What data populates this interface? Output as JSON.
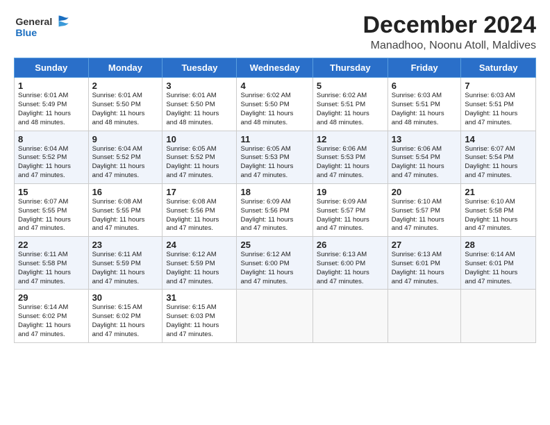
{
  "header": {
    "logo_general": "General",
    "logo_blue": "Blue",
    "title": "December 2024",
    "subtitle": "Manadhoo, Noonu Atoll, Maldives"
  },
  "days_of_week": [
    "Sunday",
    "Monday",
    "Tuesday",
    "Wednesday",
    "Thursday",
    "Friday",
    "Saturday"
  ],
  "weeks": [
    [
      {
        "day": "1",
        "info": "Sunrise: 6:01 AM\nSunset: 5:49 PM\nDaylight: 11 hours\nand 48 minutes."
      },
      {
        "day": "2",
        "info": "Sunrise: 6:01 AM\nSunset: 5:50 PM\nDaylight: 11 hours\nand 48 minutes."
      },
      {
        "day": "3",
        "info": "Sunrise: 6:01 AM\nSunset: 5:50 PM\nDaylight: 11 hours\nand 48 minutes."
      },
      {
        "day": "4",
        "info": "Sunrise: 6:02 AM\nSunset: 5:50 PM\nDaylight: 11 hours\nand 48 minutes."
      },
      {
        "day": "5",
        "info": "Sunrise: 6:02 AM\nSunset: 5:51 PM\nDaylight: 11 hours\nand 48 minutes."
      },
      {
        "day": "6",
        "info": "Sunrise: 6:03 AM\nSunset: 5:51 PM\nDaylight: 11 hours\nand 48 minutes."
      },
      {
        "day": "7",
        "info": "Sunrise: 6:03 AM\nSunset: 5:51 PM\nDaylight: 11 hours\nand 47 minutes."
      }
    ],
    [
      {
        "day": "8",
        "info": "Sunrise: 6:04 AM\nSunset: 5:52 PM\nDaylight: 11 hours\nand 47 minutes."
      },
      {
        "day": "9",
        "info": "Sunrise: 6:04 AM\nSunset: 5:52 PM\nDaylight: 11 hours\nand 47 minutes."
      },
      {
        "day": "10",
        "info": "Sunrise: 6:05 AM\nSunset: 5:52 PM\nDaylight: 11 hours\nand 47 minutes."
      },
      {
        "day": "11",
        "info": "Sunrise: 6:05 AM\nSunset: 5:53 PM\nDaylight: 11 hours\nand 47 minutes."
      },
      {
        "day": "12",
        "info": "Sunrise: 6:06 AM\nSunset: 5:53 PM\nDaylight: 11 hours\nand 47 minutes."
      },
      {
        "day": "13",
        "info": "Sunrise: 6:06 AM\nSunset: 5:54 PM\nDaylight: 11 hours\nand 47 minutes."
      },
      {
        "day": "14",
        "info": "Sunrise: 6:07 AM\nSunset: 5:54 PM\nDaylight: 11 hours\nand 47 minutes."
      }
    ],
    [
      {
        "day": "15",
        "info": "Sunrise: 6:07 AM\nSunset: 5:55 PM\nDaylight: 11 hours\nand 47 minutes."
      },
      {
        "day": "16",
        "info": "Sunrise: 6:08 AM\nSunset: 5:55 PM\nDaylight: 11 hours\nand 47 minutes."
      },
      {
        "day": "17",
        "info": "Sunrise: 6:08 AM\nSunset: 5:56 PM\nDaylight: 11 hours\nand 47 minutes."
      },
      {
        "day": "18",
        "info": "Sunrise: 6:09 AM\nSunset: 5:56 PM\nDaylight: 11 hours\nand 47 minutes."
      },
      {
        "day": "19",
        "info": "Sunrise: 6:09 AM\nSunset: 5:57 PM\nDaylight: 11 hours\nand 47 minutes."
      },
      {
        "day": "20",
        "info": "Sunrise: 6:10 AM\nSunset: 5:57 PM\nDaylight: 11 hours\nand 47 minutes."
      },
      {
        "day": "21",
        "info": "Sunrise: 6:10 AM\nSunset: 5:58 PM\nDaylight: 11 hours\nand 47 minutes."
      }
    ],
    [
      {
        "day": "22",
        "info": "Sunrise: 6:11 AM\nSunset: 5:58 PM\nDaylight: 11 hours\nand 47 minutes."
      },
      {
        "day": "23",
        "info": "Sunrise: 6:11 AM\nSunset: 5:59 PM\nDaylight: 11 hours\nand 47 minutes."
      },
      {
        "day": "24",
        "info": "Sunrise: 6:12 AM\nSunset: 5:59 PM\nDaylight: 11 hours\nand 47 minutes."
      },
      {
        "day": "25",
        "info": "Sunrise: 6:12 AM\nSunset: 6:00 PM\nDaylight: 11 hours\nand 47 minutes."
      },
      {
        "day": "26",
        "info": "Sunrise: 6:13 AM\nSunset: 6:00 PM\nDaylight: 11 hours\nand 47 minutes."
      },
      {
        "day": "27",
        "info": "Sunrise: 6:13 AM\nSunset: 6:01 PM\nDaylight: 11 hours\nand 47 minutes."
      },
      {
        "day": "28",
        "info": "Sunrise: 6:14 AM\nSunset: 6:01 PM\nDaylight: 11 hours\nand 47 minutes."
      }
    ],
    [
      {
        "day": "29",
        "info": "Sunrise: 6:14 AM\nSunset: 6:02 PM\nDaylight: 11 hours\nand 47 minutes."
      },
      {
        "day": "30",
        "info": "Sunrise: 6:15 AM\nSunset: 6:02 PM\nDaylight: 11 hours\nand 47 minutes."
      },
      {
        "day": "31",
        "info": "Sunrise: 6:15 AM\nSunset: 6:03 PM\nDaylight: 11 hours\nand 47 minutes."
      },
      null,
      null,
      null,
      null
    ]
  ]
}
